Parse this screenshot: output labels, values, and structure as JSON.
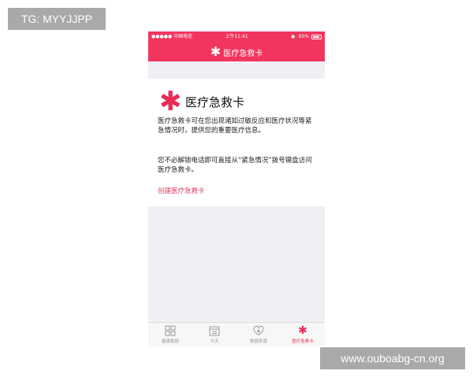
{
  "watermarks": {
    "top_left": "TG: MYYJJPP",
    "bottom_right": "www.ouboabg-cn.org"
  },
  "status_bar": {
    "carrier": "●●●●● 中国电信",
    "time": "上午11:41",
    "battery": "85%",
    "battery_level": 0.85
  },
  "nav": {
    "icon": "asterisk-icon",
    "title": "医疗急救卡"
  },
  "card": {
    "icon": "medical-asterisk-icon",
    "title": "医疗急救卡",
    "paragraph1": "医疗急救卡可在您出现诸如过敏反应和医疗状况等紧急情况时，提供您的重要医疗信息。",
    "paragraph2": "您不必解锁电话即可直接从“紧急情况”拨号键盘访问医疗急救卡。",
    "create_link": "创建医疗急救卡"
  },
  "tabs": [
    {
      "label": "健康数据",
      "icon": "grid-icon",
      "active": false
    },
    {
      "label": "今天",
      "icon": "calendar-icon",
      "active": false
    },
    {
      "label": "数据来源",
      "icon": "download-heart-icon",
      "active": false
    },
    {
      "label": "医疗急救卡",
      "icon": "medical-asterisk-icon",
      "active": true
    }
  ],
  "colors": {
    "accent": "#f2355e",
    "background": "#efeff4",
    "inactive_tab": "#9a9a9a"
  }
}
